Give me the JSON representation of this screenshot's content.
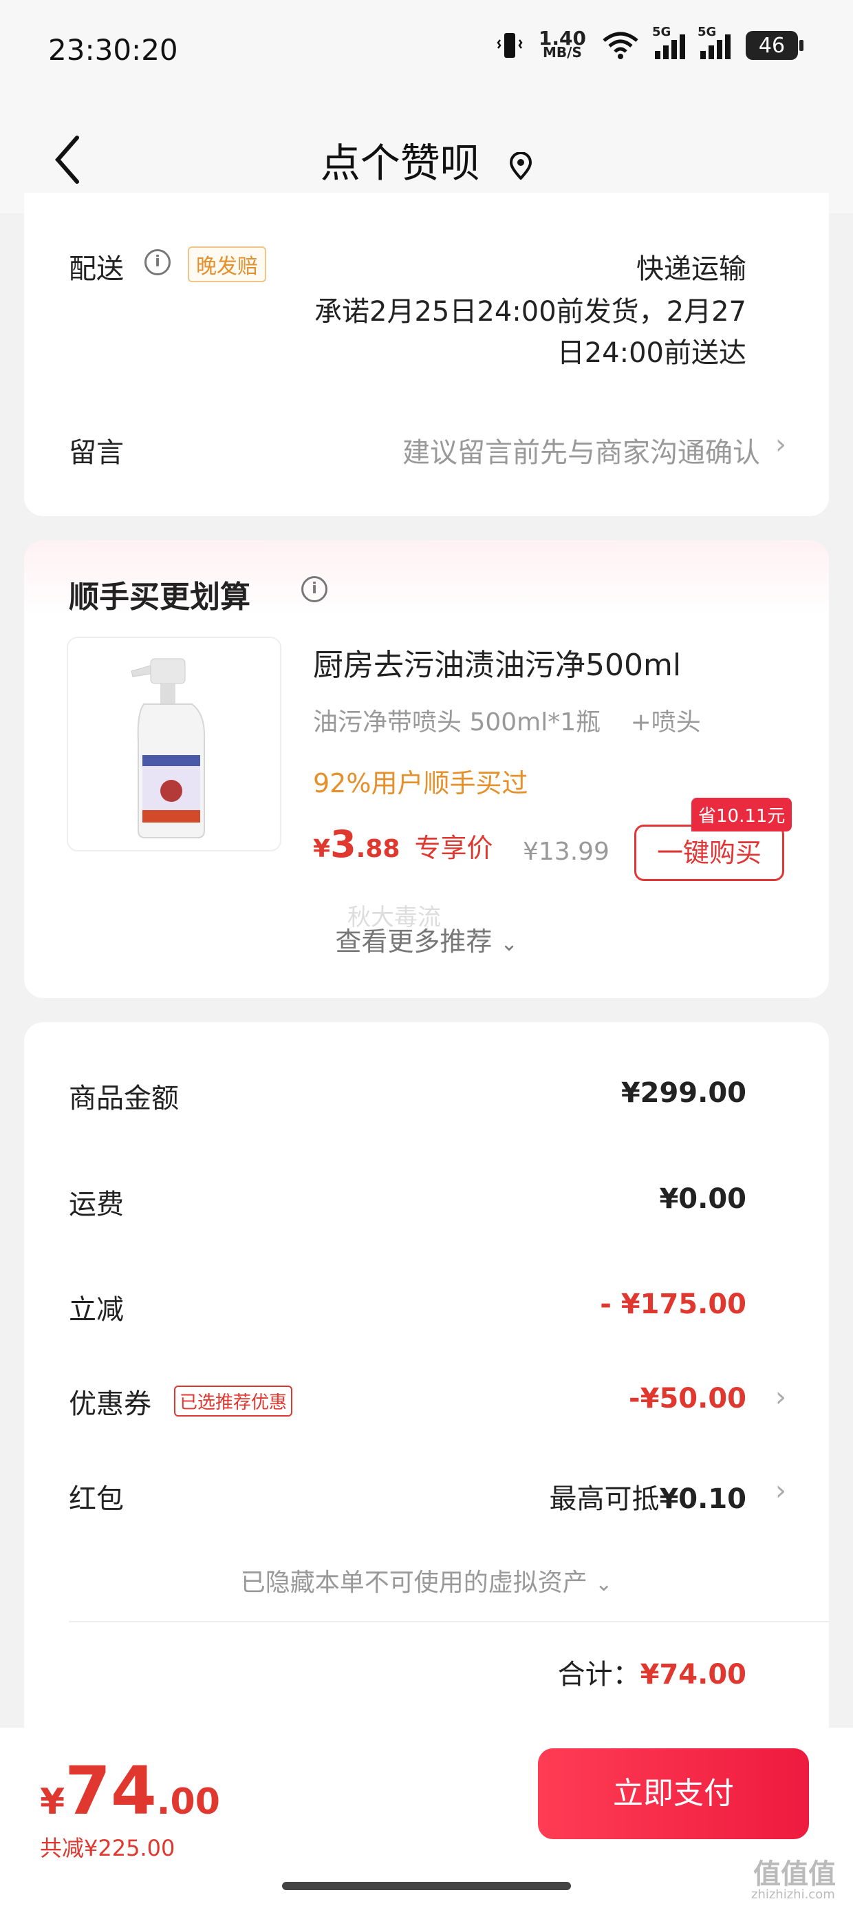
{
  "status": {
    "time": "23:30:20",
    "speed_value": "1.40",
    "speed_unit": "MB/S",
    "network1": "5G",
    "network2": "5G",
    "battery": "46"
  },
  "header": {
    "title": "点个赞呗",
    "back_icon": "chevron-left-icon",
    "location_icon": "location-pin-icon"
  },
  "delivery": {
    "label": "配送",
    "tag": "晚发赔",
    "method": "快递运输",
    "promise_line1": "承诺2月25日24:00前发货，2月27",
    "promise_line2": "日24:00前送达"
  },
  "message": {
    "label": "留言",
    "placeholder": "建议留言前先与商家沟通确认"
  },
  "recommend": {
    "title": "顺手买更划算",
    "product_title": "厨房去污油渍油污净500ml",
    "spec": "油污净带喷头 500ml*1瓶",
    "spec_extra": "+喷头",
    "social_proof": "92%用户顺手买过",
    "price_symbol": "¥",
    "price_int": "3",
    "price_dec": ".88",
    "price_label": "专享价",
    "original_price": "¥13.99",
    "save_badge": "省10.11元",
    "buy_button": "一键购买",
    "more": "查看更多推荐",
    "faint_text": "秋大毒流"
  },
  "summary": {
    "rows": [
      {
        "label": "商品金额",
        "value": "¥299.00"
      },
      {
        "label": "运费",
        "value": "¥0.00"
      },
      {
        "label": "立减",
        "value": "- ¥175.00"
      },
      {
        "label": "优惠券",
        "tag": "已选推荐优惠",
        "value": "-¥50.00"
      },
      {
        "label": "红包",
        "value_prefix": "最高可抵",
        "value": "¥0.10"
      }
    ],
    "hidden_assets": "已隐藏本单不可使用的虚拟资产",
    "total_label": "合计：",
    "total_value": "¥74.00"
  },
  "bottom": {
    "price_symbol": "¥",
    "price_int": "74",
    "price_dec": ".00",
    "saved": "共减¥225.00",
    "pay_button": "立即支付"
  },
  "watermark": {
    "text": "值值值",
    "sub": "zhizhizhi.com"
  },
  "colors": {
    "accent_red": "#e0372f",
    "pay_button": "#f0203f",
    "orange": "#e5902a"
  }
}
